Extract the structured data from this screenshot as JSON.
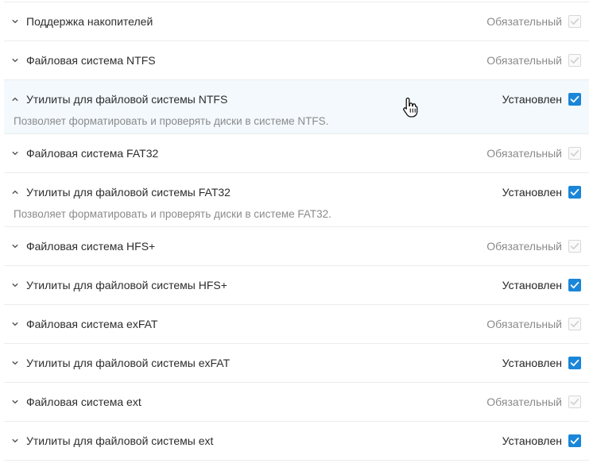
{
  "items": [
    {
      "title": "Поддержка накопителей",
      "status": "Обязательный",
      "state": "required",
      "expanded": false
    },
    {
      "title": "Файловая система NTFS",
      "status": "Обязательный",
      "state": "required",
      "expanded": false
    },
    {
      "title": "Утилиты для файловой системы NTFS",
      "status": "Установлен",
      "state": "installed",
      "expanded": true,
      "hover": true,
      "description": "Позволяет форматировать и проверять диски в системе NTFS."
    },
    {
      "title": "Файловая система FAT32",
      "status": "Обязательный",
      "state": "required",
      "expanded": false
    },
    {
      "title": "Утилиты для файловой системы FAT32",
      "status": "Установлен",
      "state": "installed",
      "expanded": true,
      "description": "Позволяет форматировать и проверять диски в системе FAT32."
    },
    {
      "title": "Файловая система HFS+",
      "status": "Обязательный",
      "state": "required",
      "expanded": false
    },
    {
      "title": "Утилиты для файловой системы HFS+",
      "status": "Установлен",
      "state": "installed",
      "expanded": false
    },
    {
      "title": "Файловая система exFAT",
      "status": "Обязательный",
      "state": "required",
      "expanded": false
    },
    {
      "title": "Утилиты для файловой системы exFAT",
      "status": "Установлен",
      "state": "installed",
      "expanded": false
    },
    {
      "title": "Файловая система ext",
      "status": "Обязательный",
      "state": "required",
      "expanded": false
    },
    {
      "title": "Утилиты для файловой системы ext",
      "status": "Установлен",
      "state": "installed",
      "expanded": false
    }
  ],
  "colors": {
    "accent": "#1a86d9",
    "hover_bg": "#f3f9fd",
    "divider": "#ececec",
    "muted_text": "#8a8a8a"
  },
  "icons": {
    "collapsed": "chevron-down-icon",
    "expanded": "chevron-up-icon",
    "checked": "checkmark-icon",
    "pointer": "hand-pointer-icon"
  }
}
